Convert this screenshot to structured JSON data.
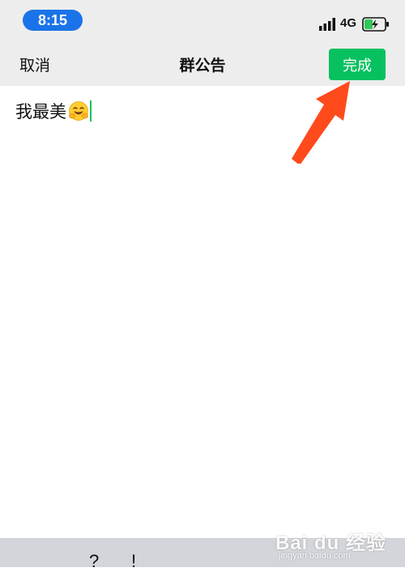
{
  "status_bar": {
    "time": "8:15",
    "network": "4G",
    "icons": [
      "signal-icon",
      "battery-charging-icon"
    ],
    "time_pill_color": "#1a73e8"
  },
  "nav": {
    "cancel_label": "取消",
    "title": "群公告",
    "done_label": "完成",
    "done_color": "#07c160"
  },
  "editor": {
    "text": "我最美",
    "emoji_icon": "hugging-face-emoji-icon",
    "cursor_color": "#07c160"
  },
  "annotation": {
    "arrow_icon": "red-arrow-icon",
    "arrow_color": "#ff4a1c"
  },
  "keyboard": {
    "keys": [
      "?",
      "!"
    ]
  },
  "watermark": {
    "logo": "Bai du 经验",
    "url": "jingyan.baidu.com"
  }
}
